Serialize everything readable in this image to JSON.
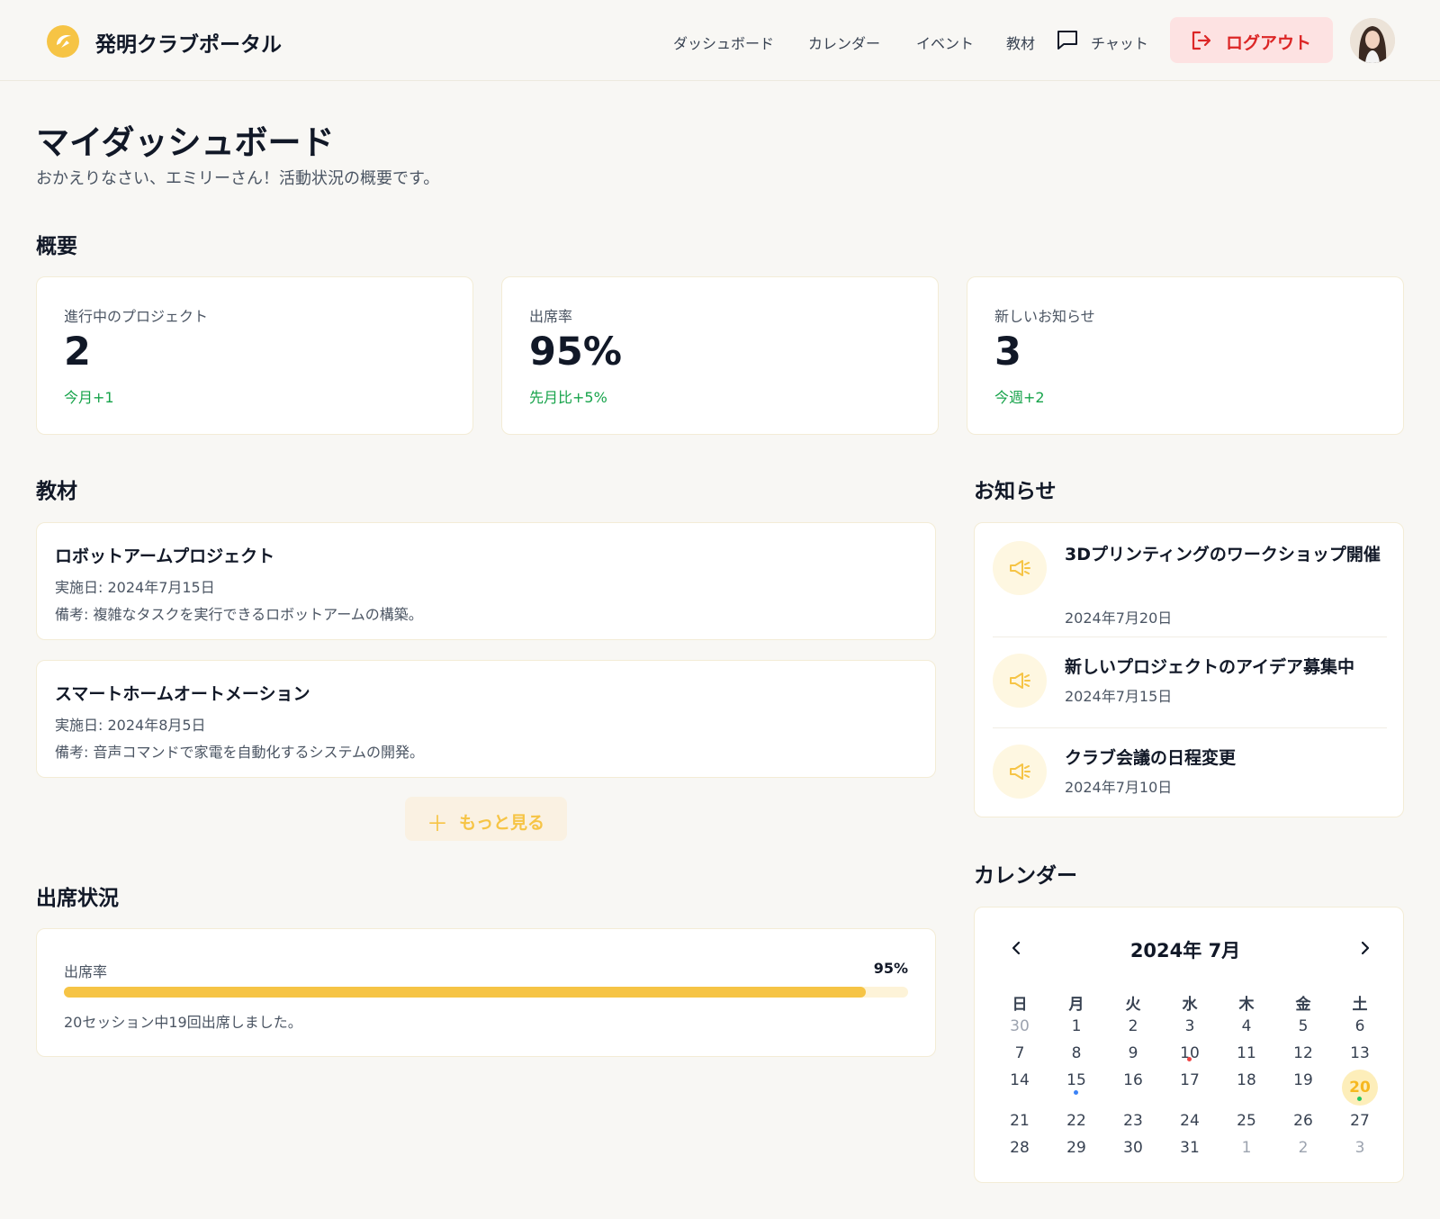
{
  "header": {
    "brand": "発明クラブポータル",
    "nav": [
      "ダッシュボード",
      "カレンダー",
      "イベント",
      "教材",
      "チャット"
    ],
    "logout": "ログアウト"
  },
  "page": {
    "title": "マイダッシュボード",
    "subtitle": "おかえりなさい、エミリーさん！活動状況の概要です。"
  },
  "overview": {
    "heading": "概要",
    "stats": [
      {
        "label": "進行中のプロジェクト",
        "value": "2",
        "change": "今月+1"
      },
      {
        "label": "出席率",
        "value": "95%",
        "change": "先月比+5%"
      },
      {
        "label": "新しいお知らせ",
        "value": "3",
        "change": "今週+2"
      }
    ]
  },
  "materials": {
    "heading": "教材",
    "items": [
      {
        "title": "ロボットアームプロジェクト",
        "date": "実施日: 2024年7月15日",
        "note": "備考: 複雑なタスクを実行できるロボットアームの構築。"
      },
      {
        "title": "スマートホームオートメーション",
        "date": "実施日: 2024年8月5日",
        "note": "備考: 音声コマンドで家電を自動化するシステムの開発。"
      }
    ],
    "more_label": "もっと見る"
  },
  "attendance": {
    "heading": "出席状況",
    "label": "出席率",
    "value_text": "95%",
    "rate": 0.95,
    "note": "20セッション中19回出席しました。"
  },
  "announcements": {
    "heading": "お知らせ",
    "items": [
      {
        "title": "3Dプリンティングのワークショップ開催",
        "date": "2024年7月20日"
      },
      {
        "title": "新しいプロジェクトのアイデア募集中",
        "date": "2024年7月15日"
      },
      {
        "title": "クラブ会議の日程変更",
        "date": "2024年7月10日"
      }
    ]
  },
  "calendar": {
    "heading": "カレンダー",
    "month_label": "2024年 7月",
    "weekdays": [
      "日",
      "月",
      "火",
      "水",
      "木",
      "金",
      "土"
    ],
    "weeks": [
      [
        "30",
        "1",
        "2",
        "3",
        "4",
        "5",
        "6"
      ],
      [
        "7",
        "8",
        "9",
        "10",
        "11",
        "12",
        "13"
      ],
      [
        "14",
        "15",
        "16",
        "17",
        "18",
        "19",
        "20"
      ],
      [
        "21",
        "22",
        "23",
        "24",
        "25",
        "26",
        "27"
      ],
      [
        "28",
        "29",
        "30",
        "31",
        "1",
        "2",
        "3"
      ]
    ],
    "today": "20",
    "colors": {
      "accent": "#f6c445",
      "event_red": "#ef4444",
      "event_blue": "#3b82f6",
      "event_green": "#22c55e"
    }
  }
}
